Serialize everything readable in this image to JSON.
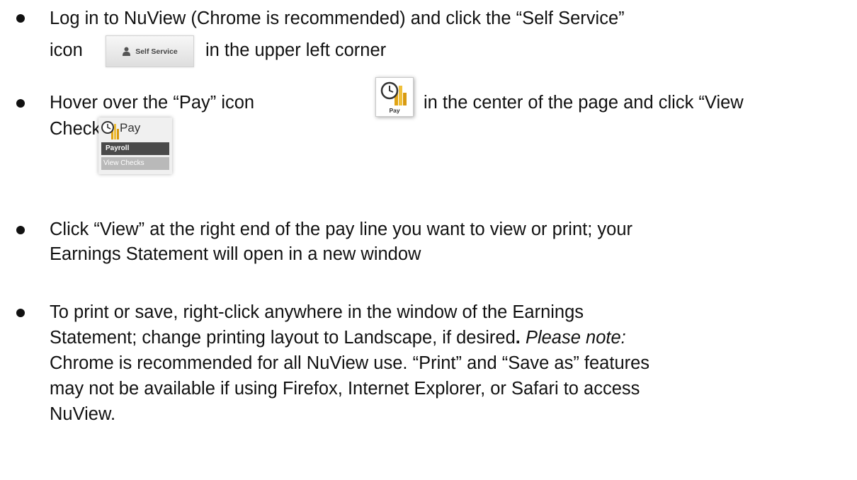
{
  "steps": [
    {
      "line1": "Log in to NuView (Chrome is recommended) and click the “Self Service”",
      "line2_before": "icon",
      "line2_after": "in the upper left corner"
    },
    {
      "line1_before": "Hover over the “Pay” icon",
      "line1_after": "in the center of the page and click “View",
      "line2": "Checks”"
    },
    {
      "line1": "Click “View” at the right end of the pay line you want to view or print; your",
      "line2": "Earnings Statement will open in a new window"
    },
    {
      "line1": "To print or save, right-click anywhere in the window of the Earnings",
      "line2_a": "Statement; change printing layout to Landscape, if desired",
      "line2_b": ".",
      "line2_c": "Please note:",
      "line3": "Chrome is recommended for all NuView use. “Print” and “Save as” features",
      "line4": "may not be available if using Firefox, Internet Explorer, or Safari to access",
      "line5": "NuView."
    }
  ],
  "self_service_button": {
    "label": "Self Service",
    "icon": "person-icon"
  },
  "pay_tile": {
    "label": "Pay",
    "icon": "clock-coins-icon"
  },
  "pay_menu": {
    "title": "Pay",
    "items": [
      "Payroll",
      "View Checks"
    ],
    "icon": "clock-coins-icon"
  }
}
